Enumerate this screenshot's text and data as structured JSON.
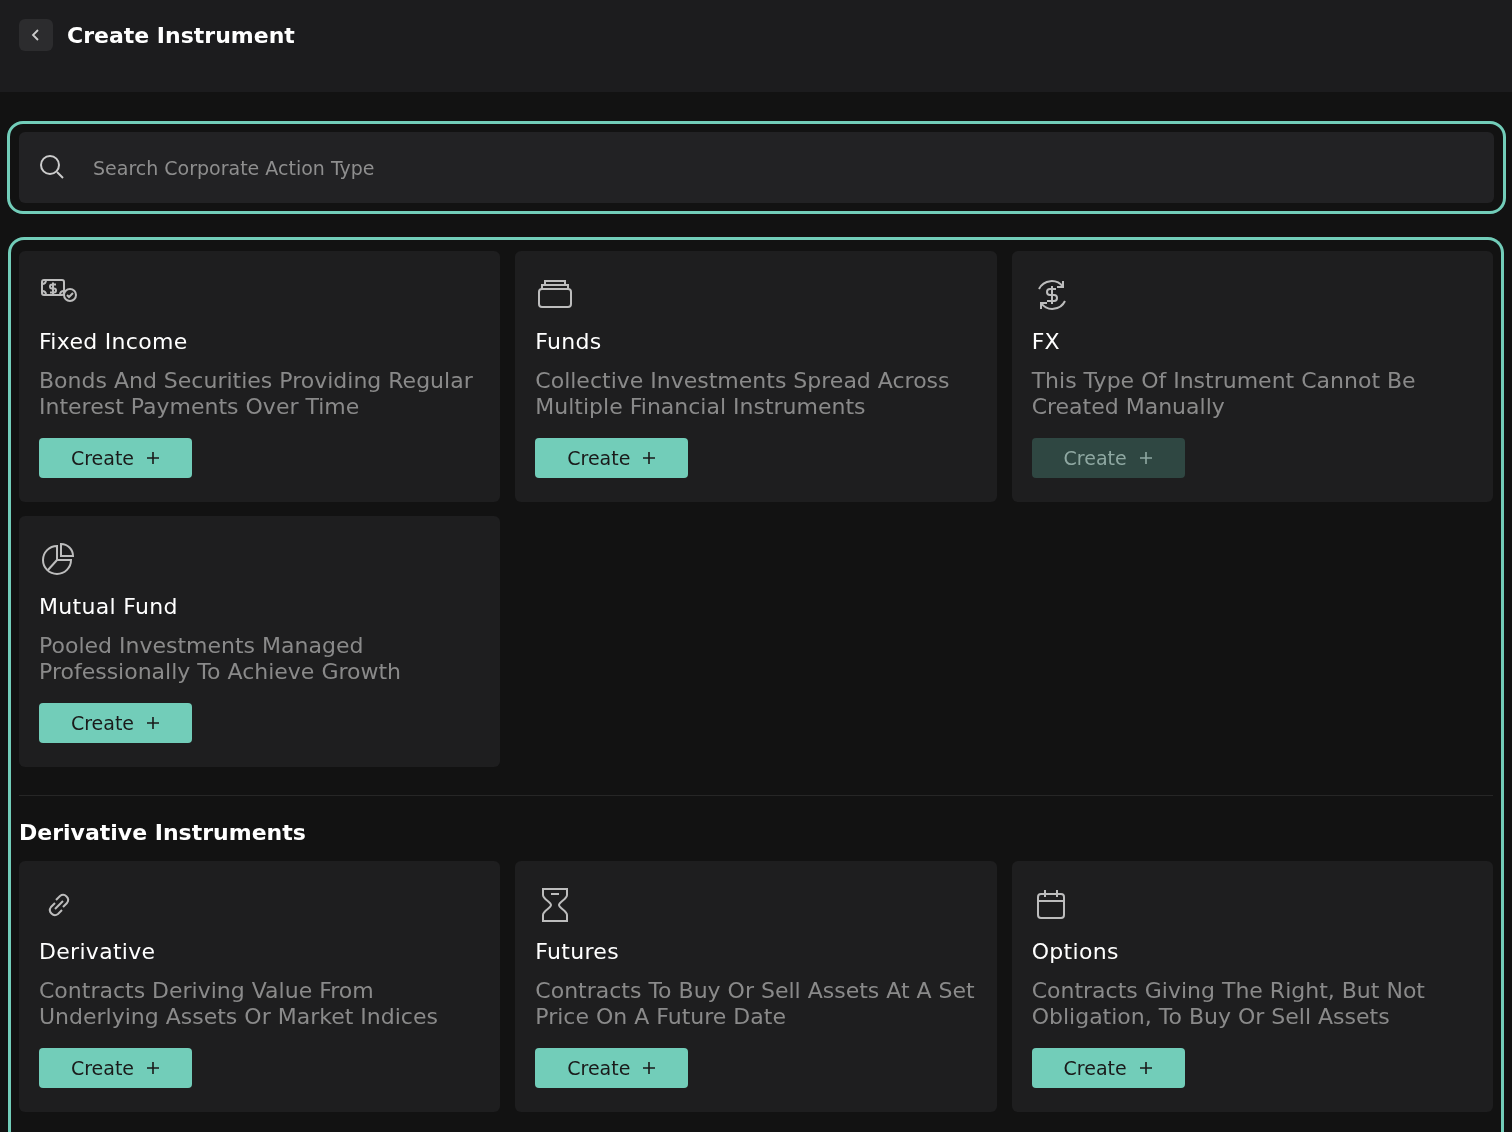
{
  "header": {
    "title": "Create Instrument"
  },
  "search": {
    "placeholder": "Search Corporate Action Type"
  },
  "groups": [
    {
      "cards": [
        {
          "kind": "cash",
          "title": "Fixed Income",
          "description": "Bonds And Securities Providing Regular Interest Payments Over Time",
          "button": "Create",
          "disabled": false
        },
        {
          "kind": "stack",
          "title": "Funds",
          "description": "Collective Investments Spread Across Multiple Financial Instruments",
          "button": "Create",
          "disabled": false
        },
        {
          "kind": "exchange",
          "title": "FX",
          "description": "This Type Of Instrument Cannot Be Created Manually",
          "button": "Create",
          "disabled": true
        },
        {
          "kind": "pie",
          "title": "Mutual Fund",
          "description": "Pooled Investments Managed Professionally To Achieve Growth",
          "button": "Create",
          "disabled": false
        }
      ]
    },
    {
      "heading": "Derivative Instruments",
      "cards": [
        {
          "kind": "link",
          "title": "Derivative",
          "description": "Contracts Deriving Value From Underlying Assets Or Market Indices",
          "button": "Create",
          "disabled": false
        },
        {
          "kind": "hourglass",
          "title": "Futures",
          "description": "Contracts To Buy Or Sell Assets At A Set Price On A Future Date",
          "button": "Create",
          "disabled": false
        },
        {
          "kind": "calendar",
          "title": "Options",
          "description": "Contracts Giving The Right, But Not Obligation, To Buy Or Sell Assets",
          "button": "Create",
          "disabled": false
        }
      ]
    }
  ]
}
